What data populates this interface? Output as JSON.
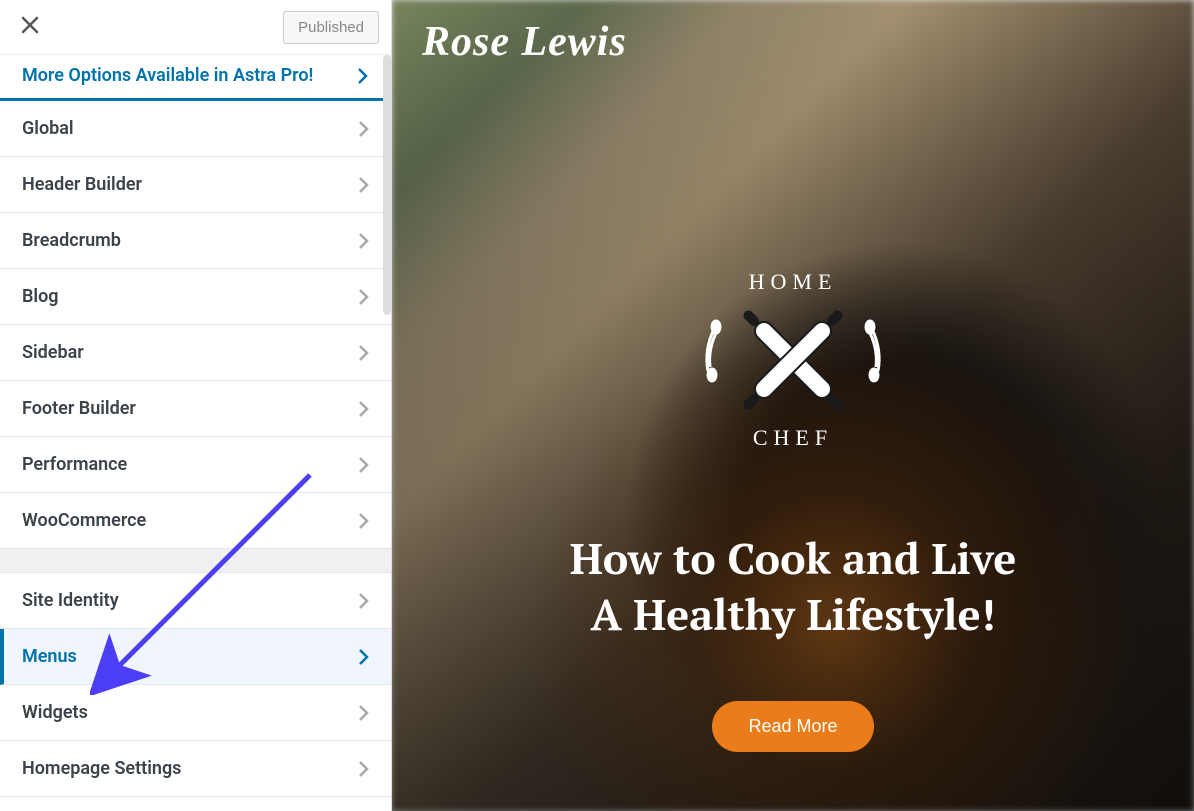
{
  "header": {
    "published_label": "Published"
  },
  "promo": {
    "label": "More Options Available in Astra Pro!"
  },
  "nav": {
    "group1": [
      {
        "label": "Global",
        "active": false
      },
      {
        "label": "Header Builder",
        "active": false
      },
      {
        "label": "Breadcrumb",
        "active": false
      },
      {
        "label": "Blog",
        "active": false
      },
      {
        "label": "Sidebar",
        "active": false
      },
      {
        "label": "Footer Builder",
        "active": false
      },
      {
        "label": "Performance",
        "active": false
      },
      {
        "label": "WooCommerce",
        "active": false
      }
    ],
    "group2": [
      {
        "label": "Site Identity",
        "active": false
      },
      {
        "label": "Menus",
        "active": true
      },
      {
        "label": "Widgets",
        "active": false
      },
      {
        "label": "Homepage Settings",
        "active": false
      }
    ]
  },
  "preview": {
    "site_name": "Rose Lewis",
    "badge_top": "HOME",
    "badge_bottom": "CHEF",
    "hero_line1": "How to Cook and Live",
    "hero_line2": "A Healthy Lifestyle!",
    "cta_label": "Read More"
  },
  "colors": {
    "accent": "#0073aa",
    "cta": "#ea7d1a",
    "arrow": "#4b3ef5"
  }
}
